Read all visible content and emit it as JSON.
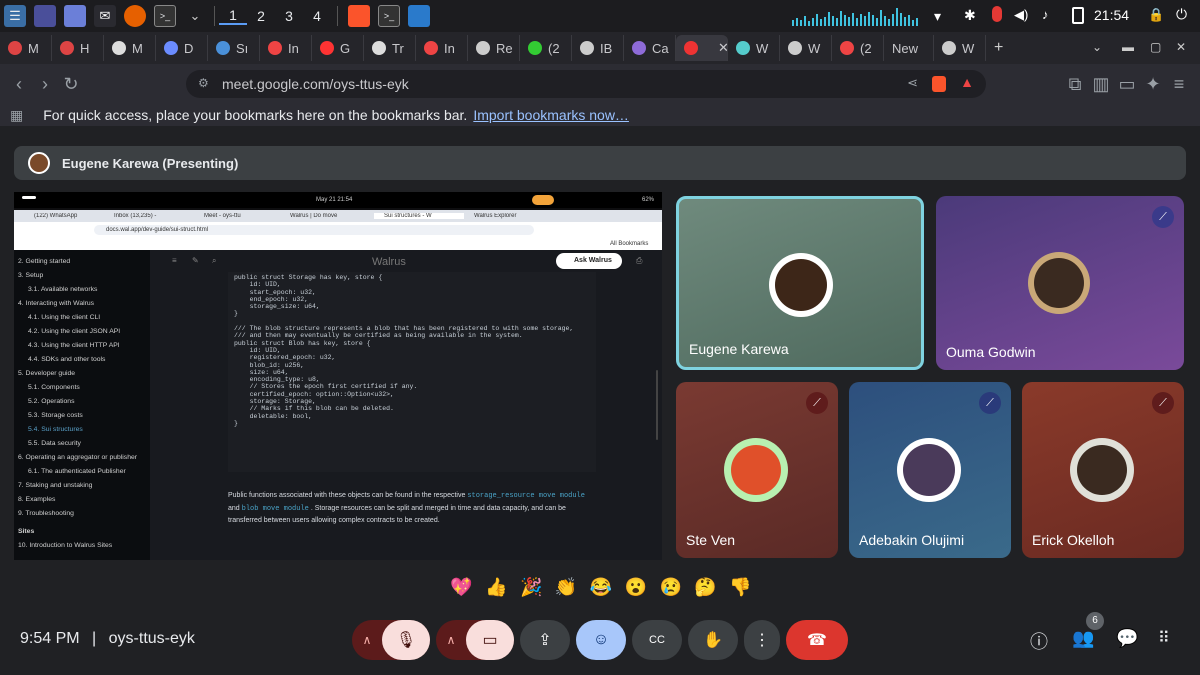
{
  "taskbar": {
    "workspaces": [
      "1",
      "2",
      "3",
      "4"
    ],
    "clock": "21:54",
    "icons": [
      "app-menu-icon",
      "display-icon",
      "folder-icon",
      "mail-icon",
      "firefox-icon",
      "terminal-icon",
      "chevron-down-icon",
      "brave-icon",
      "terminal-icon",
      "vscode-icon",
      "wifi-icon",
      "bluetooth-icon",
      "mic-muted-icon",
      "volume-icon",
      "bell-icon",
      "clipboard-icon",
      "lock-icon",
      "power-icon"
    ]
  },
  "browser": {
    "tabs": [
      {
        "label": "M",
        "icon": "gmail-icon",
        "color": "#d44"
      },
      {
        "label": "H",
        "icon": "trend-icon",
        "color": "#d44"
      },
      {
        "label": "M",
        "icon": "github-icon",
        "color": "#ddd"
      },
      {
        "label": "D",
        "icon": "d-icon",
        "color": "#6b8cff"
      },
      {
        "label": "Sı",
        "icon": "s-icon",
        "color": "#4a90d9"
      },
      {
        "label": "In",
        "icon": "gmail-icon",
        "color": "#e44"
      },
      {
        "label": "G",
        "icon": "youtube-icon",
        "color": "#f33"
      },
      {
        "label": "Tr",
        "icon": "t-icon",
        "color": "#ddd"
      },
      {
        "label": "In",
        "icon": "gmail-icon",
        "color": "#e44"
      },
      {
        "label": "Re",
        "icon": "r-icon",
        "color": "#ccc"
      },
      {
        "label": "(2",
        "icon": "whatsapp-icon",
        "color": "#3c3"
      },
      {
        "label": "IB",
        "icon": "ib-icon",
        "color": "#ccc"
      },
      {
        "label": "Ca",
        "icon": "calendar-icon",
        "color": "#8e6bd8"
      },
      {
        "label": "",
        "icon": "record-icon",
        "color": "#e33",
        "active": true
      },
      {
        "label": "W",
        "icon": "w-icon",
        "color": "#5cc"
      },
      {
        "label": "W",
        "icon": "w-icon",
        "color": "#ccc"
      },
      {
        "label": "(2",
        "icon": "chrome-icon",
        "color": "#e44"
      },
      {
        "label": "New",
        "icon": "",
        "color": ""
      },
      {
        "label": "W",
        "icon": "w-icon",
        "color": "#ccc"
      }
    ],
    "url": "meet.google.com/oys-ttus-eyk",
    "bookmarks_text": "For quick access, place your bookmarks here on the bookmarks bar.",
    "bookmarks_link": "Import bookmarks now…"
  },
  "meet": {
    "presenter": "Eugene Karewa (Presenting)",
    "participants": [
      {
        "name": "Eugene Karewa",
        "muted": false,
        "speaking": true
      },
      {
        "name": "Ouma Godwin",
        "muted": true
      },
      {
        "name": "Ste Ven",
        "muted": true
      },
      {
        "name": "Adebakin Olujimi",
        "muted": true
      },
      {
        "name": "Erick Okelloh",
        "muted": true
      }
    ],
    "reactions": [
      "💖",
      "👍",
      "🎉",
      "👏",
      "😂",
      "😮",
      "😢",
      "🤔",
      "👎"
    ],
    "time": "9:54 PM",
    "separator": "|",
    "meeting_code": "oys-ttus-eyk",
    "participant_count": "6"
  },
  "shared_screen": {
    "status_time": "May 21  21:54",
    "battery": "62%",
    "tabs": [
      "(122) WhatsApp",
      "Inbox (13,235) -",
      "Meet - oys-ttu",
      "Walrus | Do move",
      "Sui structures - W",
      "Walrus Explorer"
    ],
    "url": "docs.wal.app/dev-guide/sui-struct.html",
    "all_bookmarks": "All Bookmarks",
    "site_title": "Walrus",
    "ask_button": "Ask Walrus",
    "nav": [
      {
        "label": "2. Getting started",
        "indent": 0
      },
      {
        "label": "3. Setup",
        "indent": 0
      },
      {
        "label": "3.1. Available networks",
        "indent": 1
      },
      {
        "label": "4. Interacting with Walrus",
        "indent": 0
      },
      {
        "label": "4.1. Using the client CLI",
        "indent": 1
      },
      {
        "label": "4.2. Using the client JSON API",
        "indent": 1
      },
      {
        "label": "4.3. Using the client HTTP API",
        "indent": 1
      },
      {
        "label": "4.4. SDKs and other tools",
        "indent": 1
      },
      {
        "label": "5. Developer guide",
        "indent": 0
      },
      {
        "label": "5.1. Components",
        "indent": 1
      },
      {
        "label": "5.2. Operations",
        "indent": 1
      },
      {
        "label": "5.3. Storage costs",
        "indent": 1
      },
      {
        "label": "5.4. Sui structures",
        "indent": 1,
        "active": true
      },
      {
        "label": "5.5. Data security",
        "indent": 1
      },
      {
        "label": "6. Operating an aggregator or publisher",
        "indent": 0
      },
      {
        "label": "6.1. The authenticated Publisher",
        "indent": 1
      },
      {
        "label": "7. Staking and unstaking",
        "indent": 0
      },
      {
        "label": "8. Examples",
        "indent": 0
      },
      {
        "label": "9. Troubleshooting",
        "indent": 0
      },
      {
        "label": "Sites",
        "indent": 0,
        "bold": true
      },
      {
        "label": "10. Introduction to Walrus Sites",
        "indent": 0
      }
    ],
    "code": "public struct Storage has key, store {\n    id: UID,\n    start_epoch: u32,\n    end_epoch: u32,\n    storage_size: u64,\n}\n\n/// The blob structure represents a blob that has been registered to with some storage,\n/// and then may eventually be certified as being available in the system.\npublic struct Blob has key, store {\n    id: UID,\n    registered_epoch: u32,\n    blob_id: u256,\n    size: u64,\n    encoding_type: u8,\n    // Stores the epoch first certified if any.\n    certified_epoch: option::Option<u32>,\n    storage: Storage,\n    // Marks if this blob can be deleted.\n    deletable: bool,\n}",
    "paragraph_pre": "Public functions associated with these objects can be found in the respective",
    "paragraph_code1": "storage_resource move module",
    "paragraph_and": "and",
    "paragraph_code2": "blob move module",
    "paragraph_post": ". Storage resources can be split and merged in time and data capacity, and can be transferred between users allowing complex contracts to be created."
  }
}
